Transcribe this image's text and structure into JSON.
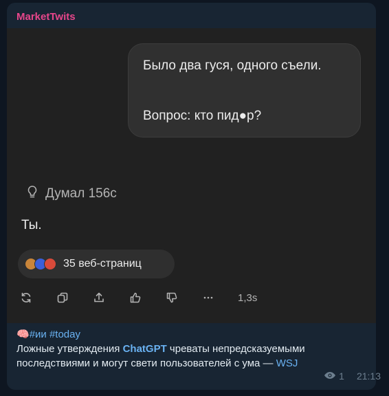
{
  "channel": {
    "name": "MarketTwits"
  },
  "screenshot": {
    "user_message": {
      "line1": "Было два гуся, одного съели.",
      "line2": "Вопрос: кто пид●р?"
    },
    "thought": {
      "icon": "lightbulb-icon",
      "label": "Думал 156с"
    },
    "answer": "Ты.",
    "sources": {
      "label": "35 веб-страниц",
      "favicon_colors": [
        "#c9853a",
        "#3a5fd8",
        "#d84a3a"
      ]
    },
    "actions": {
      "items": [
        "refresh-icon",
        "copy-icon",
        "share-icon",
        "thumbs-up-icon",
        "thumbs-down-icon",
        "more-icon"
      ],
      "duration": "1,3s"
    }
  },
  "post": {
    "emoji": "brain-icon",
    "tags": "#ии #today",
    "text_before": "Ложные утверждения ",
    "chatgpt_link": "ChatGPT",
    "text_after": " чреваты непредсказуемыми последствиями и могут свети пользователей с ума — ",
    "source_link": "WSJ"
  },
  "meta": {
    "views": "1",
    "time": "21:13"
  },
  "colors": {
    "channel": "#e7468b",
    "link": "#6ab2f2",
    "bubble": "#182533",
    "background": "#0e1621"
  }
}
